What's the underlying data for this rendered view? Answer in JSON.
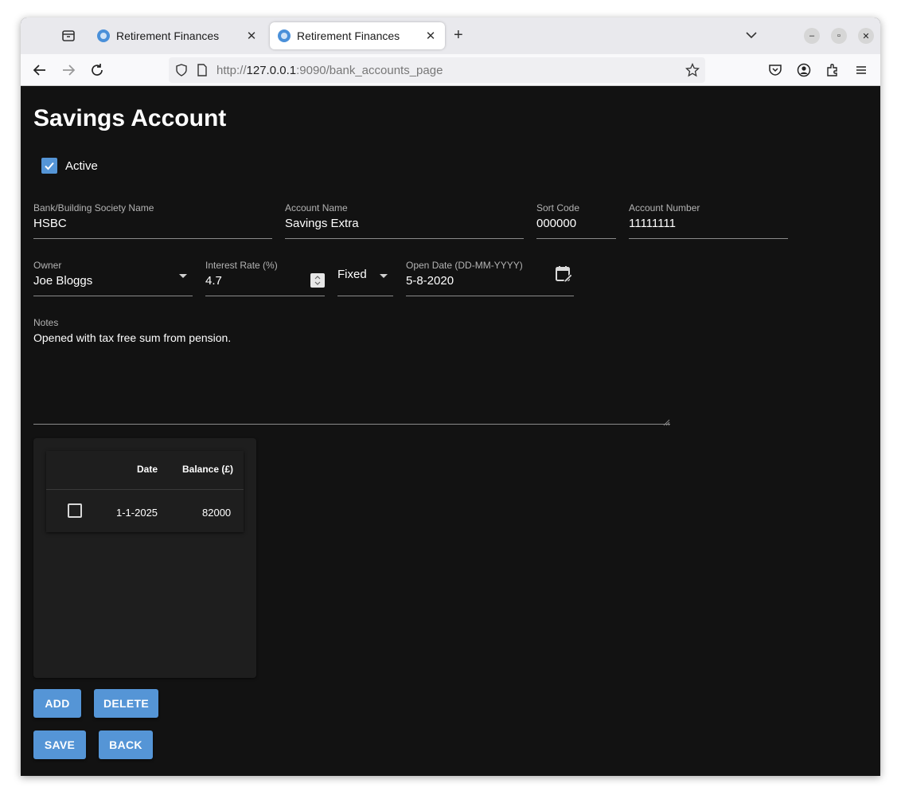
{
  "browser": {
    "tabs": [
      {
        "title": "Retirement Finances",
        "active": false
      },
      {
        "title": "Retirement Finances",
        "active": true
      }
    ],
    "url_host": "127.0.0.1",
    "url_prefix": "http://",
    "url_rest": ":9090/bank_accounts_page"
  },
  "page": {
    "title": "Savings Account",
    "active_label": "Active",
    "active_checked": true
  },
  "fields": {
    "bank_name": {
      "label": "Bank/Building Society Name",
      "value": "HSBC"
    },
    "account_name": {
      "label": "Account Name",
      "value": "Savings Extra"
    },
    "sort_code": {
      "label": "Sort Code",
      "value": "000000"
    },
    "account_number": {
      "label": "Account Number",
      "value": "11111111"
    },
    "owner": {
      "label": "Owner",
      "value": "Joe Bloggs"
    },
    "interest_rate": {
      "label": "Interest Rate (%)",
      "value": "4.7"
    },
    "rate_type": {
      "value": "Fixed"
    },
    "open_date": {
      "label": "Open Date (DD-MM-YYYY)",
      "value": "5-8-2020"
    },
    "notes": {
      "label": "Notes",
      "value": "Opened with tax free sum from pension."
    }
  },
  "table": {
    "headers": {
      "date": "Date",
      "balance": "Balance (£)"
    },
    "rows": [
      {
        "date": "1-1-2025",
        "balance": "82000",
        "selected": false
      }
    ]
  },
  "buttons": {
    "add": "ADD",
    "delete": "DELETE",
    "save": "SAVE",
    "back": "BACK"
  },
  "colors": {
    "background": "#121212",
    "accent": "#5595d6",
    "card": "#1e1e1e"
  }
}
